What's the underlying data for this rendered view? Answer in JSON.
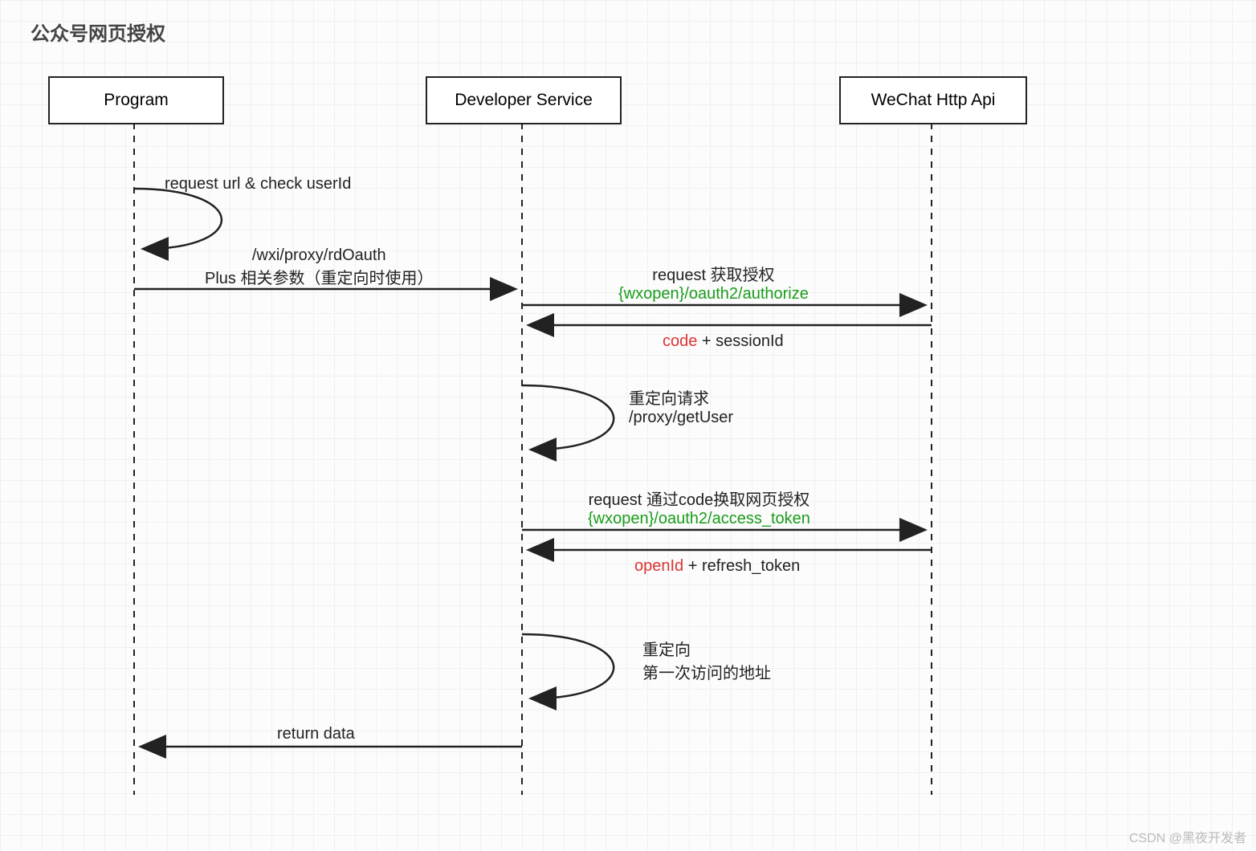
{
  "title": "公众号网页授权",
  "actors": {
    "program": "Program",
    "developer": "Developer Service",
    "wechat": "WeChat Http Api"
  },
  "steps": {
    "self1": "request url & check  userId",
    "m1_l1": "/wxi/proxy/rdOauth",
    "m1_l2": "Plus 相关参数（重定向时使用）",
    "m2_l1": "request 获取授权",
    "m2_l2_pre": "{wxopen}",
    "m2_l2_post": "/oauth2/authorize",
    "m3_pre": "code",
    "m3_post": " + sessionId",
    "self2_l1": "重定向请求",
    "self2_l2": "/proxy/getUser",
    "m4_l1": "request 通过code换取网页授权",
    "m4_l2_pre": "{wxopen}",
    "m4_l2_post": "/oauth2/access_token",
    "m5_pre": "openId",
    "m5_post": " + refresh_token",
    "self3_l1": "重定向",
    "self3_l2": "第一次访问的地址",
    "m6": "return data"
  },
  "watermark": "CSDN @黑夜开发者"
}
